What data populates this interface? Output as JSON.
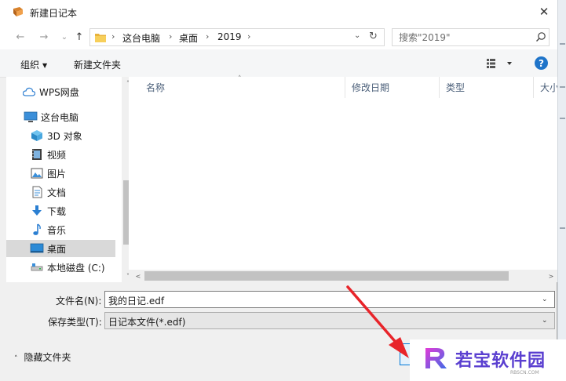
{
  "window": {
    "title": "新建日记本",
    "close_glyph": "✕"
  },
  "navigation": {
    "back_glyph": "←",
    "forward_glyph": "→",
    "recent_glyph": "⌄",
    "up_glyph": "↑",
    "breadcrumb": [
      "这台电脑",
      "桌面",
      "2019"
    ],
    "crumb_sep": "›",
    "dropdown_glyph": "⌄",
    "refresh_glyph": "↻"
  },
  "search": {
    "placeholder": "搜索\"2019\""
  },
  "toolbar": {
    "organize_label": "组织",
    "organize_caret": "▼",
    "new_folder_label": "新建文件夹",
    "help_label": "?"
  },
  "sidebar": {
    "items": [
      {
        "label": "WPS网盘",
        "icon": "cloud-icon"
      },
      {
        "label": "这台电脑",
        "icon": "computer-icon"
      },
      {
        "label": "3D 对象",
        "icon": "cube-3d-icon"
      },
      {
        "label": "视频",
        "icon": "video-icon"
      },
      {
        "label": "图片",
        "icon": "picture-icon"
      },
      {
        "label": "文档",
        "icon": "document-icon"
      },
      {
        "label": "下载",
        "icon": "download-icon"
      },
      {
        "label": "音乐",
        "icon": "music-icon"
      },
      {
        "label": "桌面",
        "icon": "desktop-icon"
      },
      {
        "label": "本地磁盘 (C:)",
        "icon": "drive-icon"
      }
    ],
    "selected": "桌面",
    "scroll_up": "˄",
    "scroll_down": "˅"
  },
  "file_list": {
    "columns": [
      "名称",
      "修改日期",
      "类型",
      "大小"
    ],
    "sort_indicator": "˄",
    "scroll_left": "<",
    "scroll_right": ">"
  },
  "form": {
    "filename_label": "文件名(N):",
    "filename_value": "我的日记.edf",
    "filetype_label": "保存类型(T):",
    "filetype_value": "日记本文件(*.edf)",
    "combo_arrow": "⌄"
  },
  "footer": {
    "hide_folders_label": "隐藏文件夹",
    "hide_folders_chevron": "˄"
  },
  "watermark": {
    "text": "若宝软件园",
    "sub": "RBSCN.COM"
  },
  "colors": {
    "accent": "#0078d7",
    "selected": "#d9d9d9",
    "arrow_red": "#e8242a",
    "watermark_purple": "#5a3fd0"
  }
}
